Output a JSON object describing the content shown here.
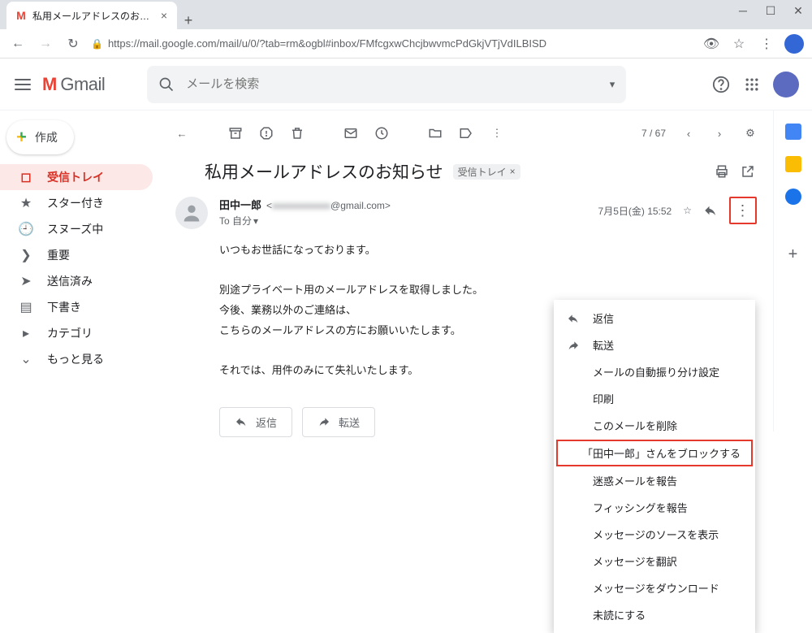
{
  "browser": {
    "tab_title": "私用メールアドレスのお知らせ -",
    "url": "https://mail.google.com/mail/u/0/?tab=rm&ogbl#inbox/FMfcgxwChcjbwvmcPdGkjVTjVdILBISD"
  },
  "gmail": {
    "brand": "Gmail",
    "search_placeholder": "メールを検索",
    "compose": "作成",
    "nav": {
      "inbox": "受信トレイ",
      "starred": "スター付き",
      "snoozed": "スヌーズ中",
      "important": "重要",
      "sent": "送信済み",
      "drafts": "下書き",
      "categories": "カテゴリ",
      "more": "もっと見る"
    },
    "toolbar": {
      "counter": "7 / 67"
    },
    "message": {
      "subject": "私用メールアドレスのお知らせ",
      "label": "受信トレイ",
      "sender_name": "田中一郎",
      "sender_email_domain": "@gmail.com",
      "to_line": "To 自分",
      "timestamp": "7月5日(金) 15:52",
      "body_line1": "いつもお世話になっております。",
      "body_line2": "別途プライベート用のメールアドレスを取得しました。",
      "body_line3": "今後、業務以外のご連絡は、",
      "body_line4": "こちらのメールアドレスの方にお願いいたします。",
      "body_line5": "それでは、用件のみにて失礼いたします。",
      "reply": "返信",
      "forward": "転送"
    },
    "menu": {
      "reply": "返信",
      "forward": "転送",
      "filter": "メールの自動振り分け設定",
      "print": "印刷",
      "delete": "このメールを削除",
      "block": "「田中一郎」さんをブロックする",
      "spam": "迷惑メールを報告",
      "phishing": "フィッシングを報告",
      "source": "メッセージのソースを表示",
      "translate": "メッセージを翻訳",
      "download": "メッセージをダウンロード",
      "unread": "未読にする"
    }
  }
}
